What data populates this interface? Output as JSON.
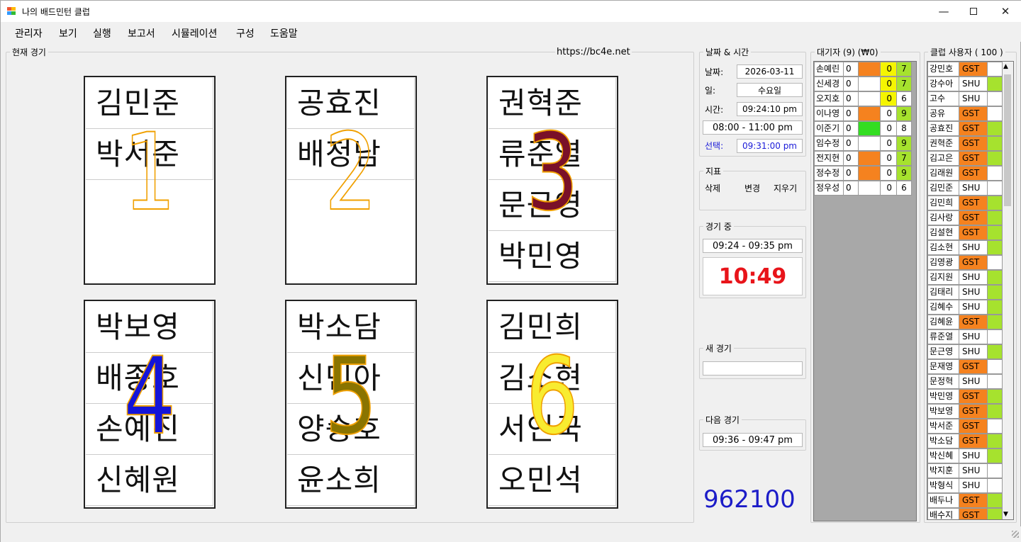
{
  "window": {
    "title": "나의 배드민턴 클럽"
  },
  "menu": [
    "관리자",
    "보기",
    "실행",
    "보고서",
    "시뮬레이션",
    "구성",
    "도움말"
  ],
  "current_games": {
    "label": "현재 경기",
    "url": "https://bc4e.net",
    "courts": [
      {
        "number": "1",
        "players": [
          "김민준",
          "박서준",
          "",
          ""
        ]
      },
      {
        "number": "2",
        "players": [
          "공효진",
          "배정남",
          "",
          ""
        ]
      },
      {
        "number": "3",
        "players": [
          "권혁준",
          "류준열",
          "문근영",
          "박민영"
        ]
      },
      {
        "number": "4",
        "players": [
          "박보영",
          "배종호",
          "손예진",
          "신혜원"
        ]
      },
      {
        "number": "5",
        "players": [
          "박소담",
          "신민아",
          "양승호",
          "윤소희"
        ]
      },
      {
        "number": "6",
        "players": [
          "김민희",
          "김소현",
          "서인국",
          "오민석"
        ]
      }
    ]
  },
  "datetime": {
    "label": "날짜 & 시간",
    "date_label": "날짜:",
    "date": "2026-03-11",
    "day_label": "일:",
    "day": "수요일",
    "time_label": "시간:",
    "time": "09:24:10 pm",
    "hours": "08:00 - 11:00 pm",
    "select_label": "선택:",
    "select_time": "09:31:00 pm"
  },
  "metrics": {
    "label": "지표",
    "delete": "삭제",
    "change": "변경",
    "clear": "지우기"
  },
  "in_game": {
    "label": "경기 중",
    "range": "09:24 - 09:35 pm",
    "timer": "10:49"
  },
  "new_game": {
    "label": "새 경기",
    "value": ""
  },
  "next_game": {
    "label": "다음 경기",
    "range": "09:36 - 09:47 pm"
  },
  "counter": "962100",
  "waiting": {
    "label": "대기자  (9)  (₩0)",
    "rows": [
      {
        "name": "손예린",
        "n1": "0",
        "c": "orange",
        "n2": "0",
        "n2c": "yellow",
        "n3": "7",
        "n3c": "green"
      },
      {
        "name": "신세경",
        "n1": "0",
        "c": "white",
        "n2": "0",
        "n2c": "yellow",
        "n3": "7",
        "n3c": "green"
      },
      {
        "name": "오지호",
        "n1": "0",
        "c": "white",
        "n2": "0",
        "n2c": "yellow",
        "n3": "6",
        "n3c": "white"
      },
      {
        "name": "이나영",
        "n1": "0",
        "c": "orange",
        "n2": "0",
        "n2c": "white",
        "n3": "9",
        "n3c": "green"
      },
      {
        "name": "이준기",
        "n1": "0",
        "c": "bgreen",
        "n2": "0",
        "n2c": "white",
        "n3": "8",
        "n3c": "white"
      },
      {
        "name": "임수정",
        "n1": "0",
        "c": "white",
        "n2": "0",
        "n2c": "white",
        "n3": "9",
        "n3c": "green"
      },
      {
        "name": "전지현",
        "n1": "0",
        "c": "orange",
        "n2": "0",
        "n2c": "white",
        "n3": "7",
        "n3c": "green"
      },
      {
        "name": "정수정",
        "n1": "0",
        "c": "orange",
        "n2": "0",
        "n2c": "white",
        "n3": "9",
        "n3c": "green"
      },
      {
        "name": "정우성",
        "n1": "0",
        "c": "white",
        "n2": "0",
        "n2c": "white",
        "n3": "6",
        "n3c": "white"
      }
    ]
  },
  "club": {
    "label": "클럽 사용자 ( 100 )",
    "rows": [
      {
        "name": "강민호",
        "type": "GST",
        "g": false
      },
      {
        "name": "강수아",
        "type": "SHU",
        "g": true
      },
      {
        "name": "고수",
        "type": "SHU",
        "g": false
      },
      {
        "name": "공유",
        "type": "GST",
        "g": false
      },
      {
        "name": "공효진",
        "type": "GST",
        "g": true
      },
      {
        "name": "권혁준",
        "type": "GST",
        "g": true
      },
      {
        "name": "김고은",
        "type": "GST",
        "g": true
      },
      {
        "name": "김래원",
        "type": "GST",
        "g": false
      },
      {
        "name": "김민준",
        "type": "SHU",
        "g": false
      },
      {
        "name": "김민희",
        "type": "GST",
        "g": true
      },
      {
        "name": "김사랑",
        "type": "GST",
        "g": true
      },
      {
        "name": "김설현",
        "type": "GST",
        "g": true
      },
      {
        "name": "김소현",
        "type": "SHU",
        "g": true
      },
      {
        "name": "김영광",
        "type": "GST",
        "g": false
      },
      {
        "name": "김지원",
        "type": "SHU",
        "g": true
      },
      {
        "name": "김태리",
        "type": "SHU",
        "g": true
      },
      {
        "name": "김혜수",
        "type": "SHU",
        "g": true
      },
      {
        "name": "김혜윤",
        "type": "GST",
        "g": true
      },
      {
        "name": "류준열",
        "type": "SHU",
        "g": false
      },
      {
        "name": "문근영",
        "type": "SHU",
        "g": true
      },
      {
        "name": "문재영",
        "type": "GST",
        "g": false
      },
      {
        "name": "문정혁",
        "type": "SHU",
        "g": false
      },
      {
        "name": "박민영",
        "type": "GST",
        "g": true
      },
      {
        "name": "박보영",
        "type": "GST",
        "g": true
      },
      {
        "name": "박서준",
        "type": "GST",
        "g": false
      },
      {
        "name": "박소담",
        "type": "GST",
        "g": true
      },
      {
        "name": "박신혜",
        "type": "SHU",
        "g": true
      },
      {
        "name": "박지훈",
        "type": "SHU",
        "g": false
      },
      {
        "name": "박형식",
        "type": "SHU",
        "g": false
      },
      {
        "name": "배두나",
        "type": "GST",
        "g": true
      },
      {
        "name": "배수지",
        "type": "GST",
        "g": true
      }
    ]
  },
  "colors": {
    "orange": "#f5821f",
    "green": "#a6e22e",
    "bgreen": "#33dd22",
    "yellow": "#f5f500",
    "timer_red": "#e8141a",
    "counter_blue": "#1c1cc8",
    "url_blue": "#1a1ad8"
  }
}
